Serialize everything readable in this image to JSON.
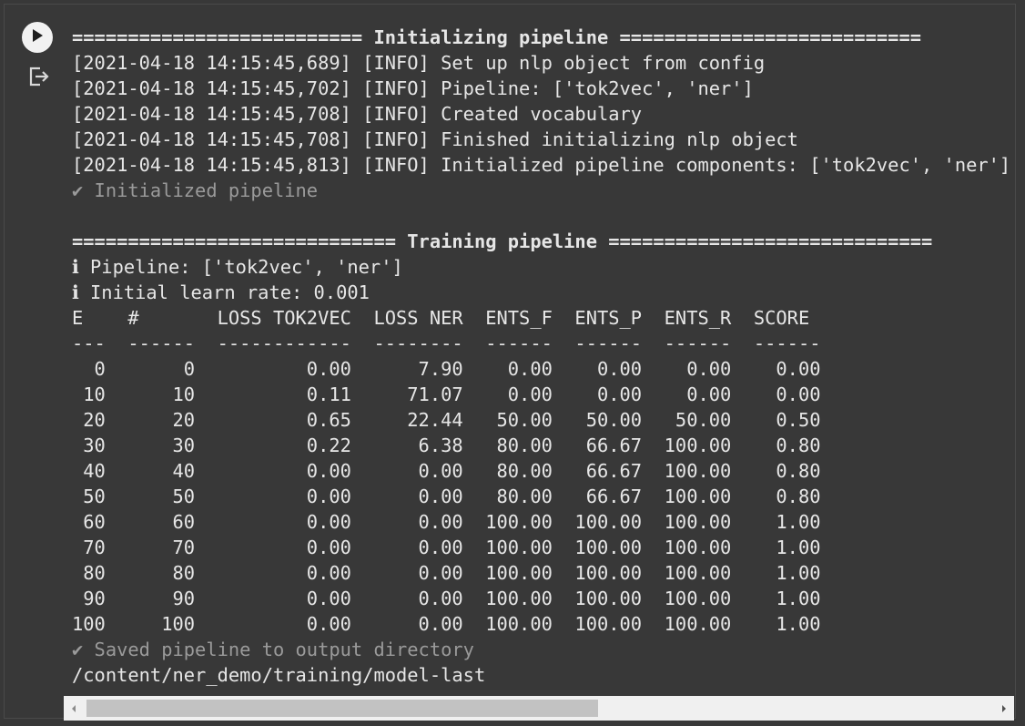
{
  "cell": {
    "run_icon": "play-icon",
    "output_icon": "output-export-icon"
  },
  "output": {
    "lines": [
      {
        "text": "========================== Initializing pipeline ===========================",
        "style": "bold"
      },
      {
        "text": "[2021-04-18 14:15:45,689] [INFO] Set up nlp object from config",
        "style": ""
      },
      {
        "text": "[2021-04-18 14:15:45,702] [INFO] Pipeline: ['tok2vec', 'ner']",
        "style": ""
      },
      {
        "text": "[2021-04-18 14:15:45,708] [INFO] Created vocabulary",
        "style": ""
      },
      {
        "text": "[2021-04-18 14:15:45,708] [INFO] Finished initializing nlp object",
        "style": ""
      },
      {
        "text": "[2021-04-18 14:15:45,813] [INFO] Initialized pipeline components: ['tok2vec', 'ner']",
        "style": ""
      },
      {
        "text": "✔ Initialized pipeline",
        "style": "dim"
      },
      {
        "text": "",
        "style": ""
      },
      {
        "text": "============================= Training pipeline =============================",
        "style": "bold"
      },
      {
        "text": "ℹ Pipeline: ['tok2vec', 'ner']",
        "style": ""
      },
      {
        "text": "ℹ Initial learn rate: 0.001",
        "style": ""
      },
      {
        "text": "E    #       LOSS TOK2VEC  LOSS NER  ENTS_F  ENTS_P  ENTS_R  SCORE ",
        "style": ""
      },
      {
        "text": "---  ------  ------------  --------  ------  ------  ------  ------",
        "style": ""
      },
      {
        "text": "  0       0          0.00      7.90    0.00    0.00    0.00    0.00",
        "style": ""
      },
      {
        "text": " 10      10          0.11     71.07    0.00    0.00    0.00    0.00",
        "style": ""
      },
      {
        "text": " 20      20          0.65     22.44   50.00   50.00   50.00    0.50",
        "style": ""
      },
      {
        "text": " 30      30          0.22      6.38   80.00   66.67  100.00    0.80",
        "style": ""
      },
      {
        "text": " 40      40          0.00      0.00   80.00   66.67  100.00    0.80",
        "style": ""
      },
      {
        "text": " 50      50          0.00      0.00   80.00   66.67  100.00    0.80",
        "style": ""
      },
      {
        "text": " 60      60          0.00      0.00  100.00  100.00  100.00    1.00",
        "style": ""
      },
      {
        "text": " 70      70          0.00      0.00  100.00  100.00  100.00    1.00",
        "style": ""
      },
      {
        "text": " 80      80          0.00      0.00  100.00  100.00  100.00    1.00",
        "style": ""
      },
      {
        "text": " 90      90          0.00      0.00  100.00  100.00  100.00    1.00",
        "style": ""
      },
      {
        "text": "100     100          0.00      0.00  100.00  100.00  100.00    1.00",
        "style": ""
      },
      {
        "text": "✔ Saved pipeline to output directory",
        "style": "dim"
      },
      {
        "text": "/content/ner_demo/training/model-last",
        "style": ""
      }
    ]
  },
  "scrollbar": {
    "left_arrow_icon": "scroll-left-icon",
    "right_arrow_icon": "scroll-right-icon",
    "position_fraction": 0.0,
    "visible_fraction": 0.55
  }
}
